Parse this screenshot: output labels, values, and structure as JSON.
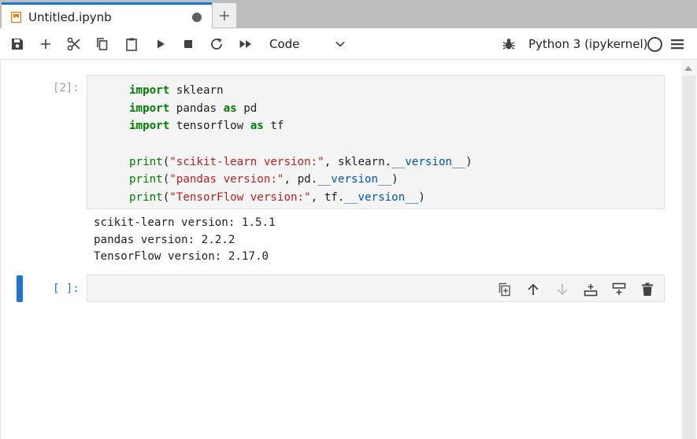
{
  "tab": {
    "title": "Untitled.ipynb"
  },
  "toolbar": {
    "cell_type": "Code",
    "kernel": "Python 3 (ipykernel)"
  },
  "cells": [
    {
      "prompt": "[2]:",
      "code": [
        [
          {
            "t": "kw",
            "v": "import"
          },
          {
            "t": "",
            "v": " sklearn"
          }
        ],
        [
          {
            "t": "kw",
            "v": "import"
          },
          {
            "t": "",
            "v": " pandas "
          },
          {
            "t": "kw",
            "v": "as"
          },
          {
            "t": "",
            "v": " pd"
          }
        ],
        [
          {
            "t": "kw",
            "v": "import"
          },
          {
            "t": "",
            "v": " tensorflow "
          },
          {
            "t": "kw",
            "v": "as"
          },
          {
            "t": "",
            "v": " tf"
          }
        ],
        [],
        [
          {
            "t": "fn",
            "v": "print"
          },
          {
            "t": "",
            "v": "("
          },
          {
            "t": "str",
            "v": "\"scikit-learn version:\""
          },
          {
            "t": "",
            "v": ", sklearn."
          },
          {
            "t": "attr",
            "v": "__version__"
          },
          {
            "t": "",
            "v": ")"
          }
        ],
        [
          {
            "t": "fn",
            "v": "print"
          },
          {
            "t": "",
            "v": "("
          },
          {
            "t": "str",
            "v": "\"pandas version:\""
          },
          {
            "t": "",
            "v": ", pd."
          },
          {
            "t": "attr",
            "v": "__version__"
          },
          {
            "t": "",
            "v": ")"
          }
        ],
        [
          {
            "t": "fn",
            "v": "print"
          },
          {
            "t": "",
            "v": "("
          },
          {
            "t": "str",
            "v": "\"TensorFlow version:\""
          },
          {
            "t": "",
            "v": ", tf."
          },
          {
            "t": "attr",
            "v": "__version__"
          },
          {
            "t": "",
            "v": ")"
          }
        ]
      ],
      "output": [
        "scikit-learn version: 1.5.1",
        "pandas version: 2.2.2",
        "TensorFlow version: 2.17.0"
      ]
    },
    {
      "prompt": "[ ]:"
    }
  ]
}
